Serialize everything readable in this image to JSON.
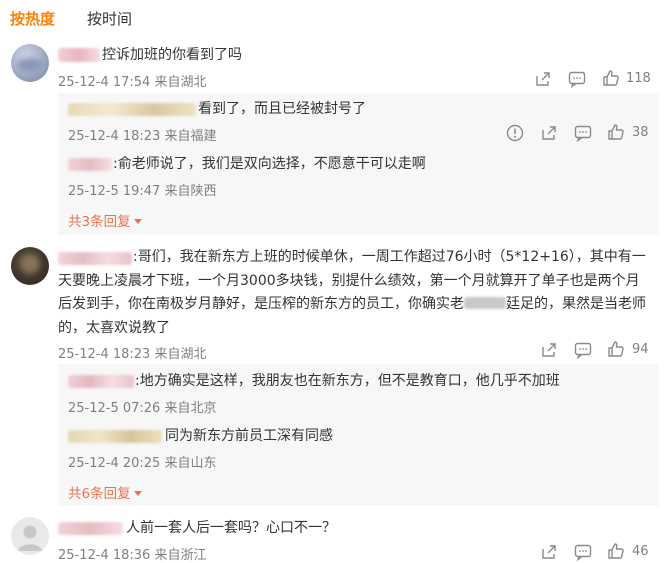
{
  "tabs": [
    {
      "label": "按热度",
      "active": true
    },
    {
      "label": "按时间",
      "active": false
    }
  ],
  "comments": [
    {
      "text": "控诉加班的你看到了吗",
      "meta": "25-12-4 17:54 来自湖北",
      "likes": "118",
      "replies": [
        {
          "text": "看到了，而且已经被封号了",
          "meta": "25-12-4 18:23 来自福建",
          "likes": "38"
        },
        {
          "text": ":俞老师说了，我们是双向选择，不愿意干可以走啊",
          "meta": "25-12-5 19:47 来自陕西"
        }
      ],
      "more_label": "共3条回复"
    },
    {
      "text": ":哥们，我在新东方上班的时候单休，一周工作超过76小时（5*12+16），其中有一天要晚上凌晨才下班，一个月3000多块钱，别提什么绩效，第一个月就算开了单子也是两个月后发到手，你在南极岁月静好，是压榨的新东方的员工，你确实老",
      "text_tail": "廷足的，果然是当老师的，太喜欢说教了",
      "meta": "25-12-4 18:23 来自湖北",
      "likes": "94",
      "replies": [
        {
          "text": ":地方确实是这样，我朋友也在新东方，但不是教育口，他几乎不加班",
          "meta": "25-12-5 07:26 来自北京"
        },
        {
          "text": "同为新东方前员工深有同感",
          "meta": "25-12-4 20:25 来自山东"
        }
      ],
      "more_label": "共6条回复"
    },
    {
      "text": "人前一套人后一套吗？心口不一？",
      "meta": "25-12-4 18:36 来自浙江",
      "likes": "46"
    }
  ],
  "colors": {
    "accent": "#ff8200",
    "more": "#eb7350",
    "meta": "#808080",
    "icon": "#8a8a8a"
  },
  "icons": [
    "share-icon",
    "comment-icon",
    "like-icon",
    "report-icon"
  ]
}
